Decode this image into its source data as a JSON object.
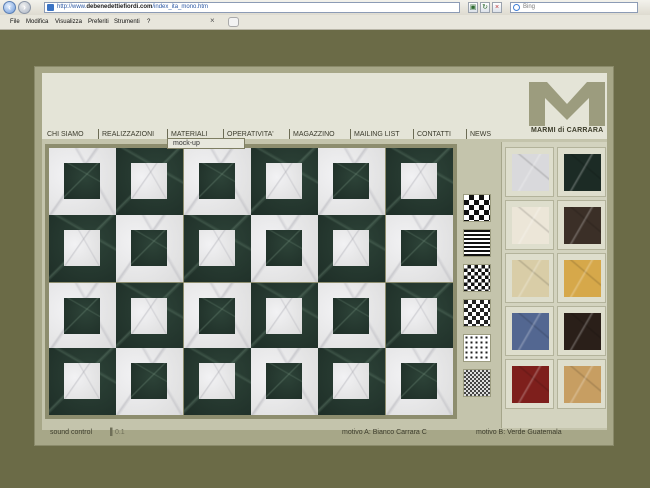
{
  "browser": {
    "url_prefix": "http://www.",
    "url_host": "debenedettiefiordi.com",
    "url_path": "/index_ita_mono.htm",
    "search_placeholder": "Bing",
    "menu": [
      "File",
      "Modifica",
      "Visualizza",
      "Preferiti",
      "Strumenti",
      "?"
    ]
  },
  "site": {
    "logo_text": "MARMI di CARRARA",
    "nav": [
      "CHI SIAMO",
      "REALIZZAZIONI",
      "MATERIALI",
      "OPERATIVITA'",
      "MAGAZZINO",
      "MAILING LIST",
      "CONTATTI",
      "NEWS"
    ],
    "active_nav": "MATERIALI",
    "dropdown_item": "mock-up"
  },
  "footer": {
    "sound_label": "sound control",
    "volume_indicator": "▌0.1",
    "motivo_a": "motivo A: Bianco Carrara C",
    "motivo_b": "motivo B: Verde Guatemala"
  },
  "colors": {
    "white_marble": "#dcdcdc",
    "green_marble": "#1e2e27",
    "olive_bg": "#6b6b47",
    "frame": "#a7a788"
  },
  "floor_pattern": {
    "rows": 4,
    "cols": 6,
    "outer_a_positions": [
      [
        0,
        0
      ],
      [
        0,
        2
      ],
      [
        0,
        4
      ],
      [
        1,
        1
      ],
      [
        1,
        3
      ],
      [
        1,
        5
      ],
      [
        2,
        0
      ],
      [
        2,
        2
      ],
      [
        2,
        4
      ],
      [
        3,
        1
      ],
      [
        3,
        3
      ],
      [
        3,
        5
      ]
    ]
  },
  "patterns": [
    "checker-large",
    "stripes",
    "checker-medium",
    "checker-framed",
    "dots-border",
    "checker-fine"
  ],
  "swatches": [
    {
      "name": "bianco-carrara",
      "color": "#d9d9dc"
    },
    {
      "name": "verde-guatemala",
      "color": "#1c2b25"
    },
    {
      "name": "calacatta",
      "color": "#ece6d8"
    },
    {
      "name": "emperador-dark",
      "color": "#3b2f27"
    },
    {
      "name": "botticino",
      "color": "#d9cda7"
    },
    {
      "name": "giallo-siena",
      "color": "#d6a84a"
    },
    {
      "name": "azul-bahia",
      "color": "#536791"
    },
    {
      "name": "marrone-nero",
      "color": "#2a1f19"
    },
    {
      "name": "rosso-levanto",
      "color": "#7e1f1c"
    },
    {
      "name": "onice-miele",
      "color": "#c79e62"
    }
  ]
}
